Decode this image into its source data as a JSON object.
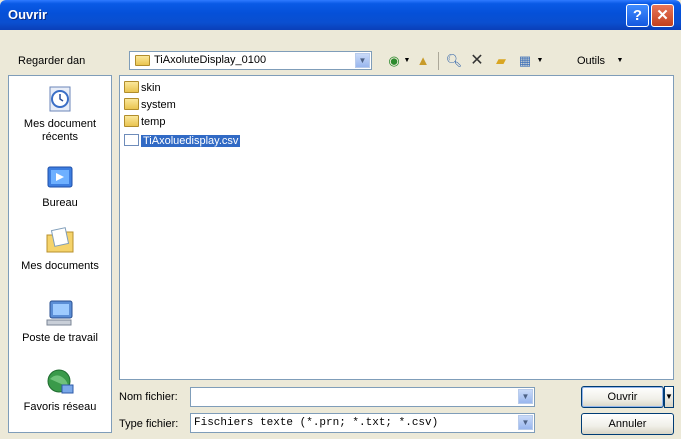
{
  "window": {
    "title": "Ouvrir"
  },
  "toolbar": {
    "look_in_label": "Regarder dan",
    "look_in_value": "TiAxoluteDisplay_0100",
    "tools_label": "Outils"
  },
  "places": [
    {
      "label": "Mes document récents",
      "icon": "recent-documents-icon"
    },
    {
      "label": "Bureau",
      "icon": "desktop-icon"
    },
    {
      "label": "Mes documents",
      "icon": "my-documents-icon"
    },
    {
      "label": "Poste de travail",
      "icon": "my-computer-icon"
    },
    {
      "label": "Favoris réseau",
      "icon": "network-places-icon"
    }
  ],
  "files": [
    {
      "name": "skin",
      "type": "folder"
    },
    {
      "name": "system",
      "type": "folder"
    },
    {
      "name": "temp",
      "type": "folder"
    },
    {
      "name": "TiAxoluedisplay.csv",
      "type": "file",
      "selected": true
    }
  ],
  "filename": {
    "label": "Nom fichier:",
    "value": ""
  },
  "filetype": {
    "label": "Type fichier:",
    "value": "Fischiers texte (*.prn; *.txt; *.csv)"
  },
  "buttons": {
    "open": "Ouvrir",
    "cancel": "Annuler"
  }
}
